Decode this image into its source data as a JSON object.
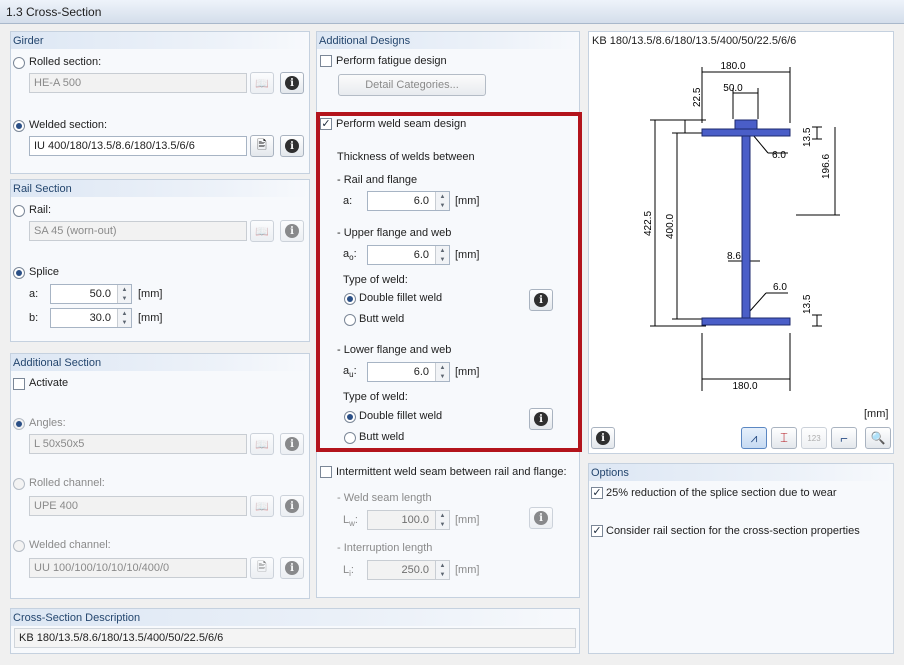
{
  "window": {
    "title": "1.3 Cross-Section"
  },
  "girder": {
    "title": "Girder",
    "rolled_label": "Rolled section:",
    "rolled_value": "HE-A 500",
    "welded_label": "Welded section:",
    "welded_value": "IU 400/180/13.5/8.6/180/13.5/6/6"
  },
  "rail": {
    "title": "Rail Section",
    "rail_label": "Rail:",
    "rail_value": "SA 45 (worn-out)",
    "splice_label": "Splice",
    "a_label": "a:",
    "a_value": "50.0",
    "a_unit": "[mm]",
    "b_label": "b:",
    "b_value": "30.0",
    "b_unit": "[mm]"
  },
  "additional_section": {
    "title": "Additional Section",
    "activate_label": "Activate",
    "angles_label": "Angles:",
    "angles_value": "L 50x50x5",
    "rolled_channel_label": "Rolled channel:",
    "rolled_channel_value": "UPE 400",
    "welded_channel_label": "Welded channel:",
    "welded_channel_value": "UU 100/100/10/10/10/400/0"
  },
  "description": {
    "title": "Cross-Section Description",
    "value": "KB 180/13.5/8.6/180/13.5/400/50/22.5/6/6"
  },
  "additional_designs": {
    "title": "Additional Designs",
    "fatigue_label": "Perform fatigue design",
    "detail_button": "Detail Categories...",
    "weld_label": "Perform weld seam design",
    "thickness_title": "Thickness of welds between",
    "rail_flange": "- Rail and flange",
    "a_label": "a:",
    "a_value": "6.0",
    "unit": "[mm]",
    "upper": "- Upper flange and web",
    "ao_label": "a",
    "ao_sub": "o",
    "ao_value": "6.0",
    "type_label": "Type of weld:",
    "double_fillet": "Double fillet weld",
    "butt": "Butt weld",
    "lower": "- Lower flange and web",
    "au_label": "a",
    "au_sub": "u",
    "au_value": "6.0",
    "intermittent_label": "Intermittent weld seam between rail and flange:",
    "seam_length_label": "- Weld seam length",
    "lw_label": "L",
    "lw_sub": "w",
    "lw_value": "100.0",
    "interruption_label": "- Interruption length",
    "li_label": "L",
    "li_sub": "i",
    "li_value": "250.0"
  },
  "preview": {
    "title": "KB 180/13.5/8.6/180/13.5/400/50/22.5/6/6",
    "unit": "[mm]",
    "dims": {
      "top_width": "180.0",
      "rail_width": "50.0",
      "rail_height": "22.5",
      "weld_top": "6.0",
      "flange_top": "13.5",
      "upper_depth": "196.6",
      "total_height": "422.5",
      "web_height": "400.0",
      "web_thickness": "8.6",
      "weld_bottom": "6.0",
      "flange_bottom": "13.5",
      "bottom_width": "180.0"
    },
    "accent_color": "#4a5ec8"
  },
  "options": {
    "title": "Options",
    "reduction_label": "25% reduction of the splice section due to wear",
    "consider_label": "Consider rail section for the cross-section properties"
  },
  "highlight_color": "#b3141c"
}
